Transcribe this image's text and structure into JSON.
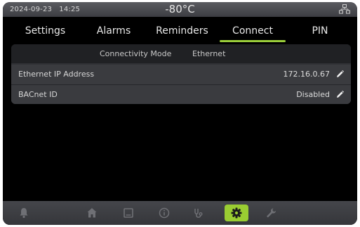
{
  "status": {
    "date": "2024-09-23",
    "time": "14:25",
    "temperature": "-80°C",
    "network_icon": "network-icon"
  },
  "tabs": [
    {
      "label": "Settings"
    },
    {
      "label": "Alarms"
    },
    {
      "label": "Reminders"
    },
    {
      "label": "Connect",
      "active": true
    },
    {
      "label": "PIN"
    }
  ],
  "connect": {
    "mode_label": "Connectivity Mode",
    "mode_value": "Ethernet",
    "ip_label": "Ethernet IP Address",
    "ip_value": "172.16.0.67",
    "bacnet_label": "BACnet ID",
    "bacnet_value": "Disabled"
  },
  "nav": {
    "items": [
      "bell-icon",
      "home-icon",
      "log-icon",
      "info-icon",
      "stethoscope-icon",
      "gear-icon",
      "wrench-icon"
    ],
    "active": "gear-icon"
  },
  "colors": {
    "accent": "#9acd32",
    "background": "#000000",
    "panel": "#313236",
    "statusbar": "#4a4b50"
  }
}
